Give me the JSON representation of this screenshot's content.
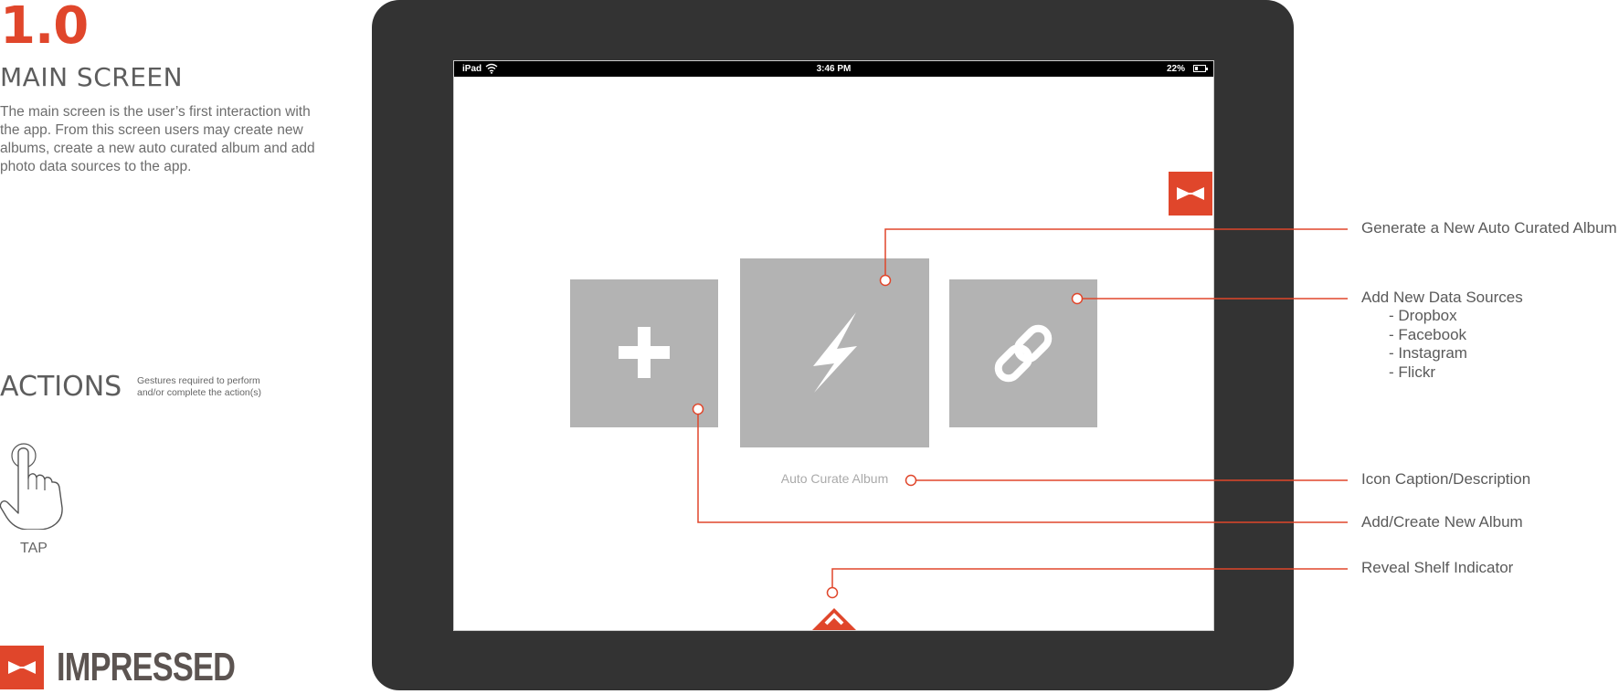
{
  "section": {
    "number": "1.0",
    "title": "MAIN SCREEN",
    "description": "The main screen is the user’s first interaction with the app.  From this screen users may create new albums, create a new auto curated album and add photo data sources to the app."
  },
  "actions": {
    "title": "ACTIONS",
    "note": "Gestures required to perform and/or complete the action(s)",
    "gesture_label": "TAP"
  },
  "brand": {
    "name": "IMPRESSED"
  },
  "status_bar": {
    "carrier": "iPad",
    "time": "3:46 PM",
    "battery": "22%"
  },
  "screen": {
    "caption": "Auto Curate Album",
    "icons": {
      "menu": "bowtie-icon",
      "add_album": "plus-icon",
      "auto_curate": "lightning-bolt-icon",
      "data_sources": "link-icon",
      "shelf": "chevron-up-icon"
    }
  },
  "callouts": {
    "generate": "Generate a New Auto Curated Album",
    "sources": "Add New Data Sources",
    "sources_list": [
      "- Dropbox",
      "- Facebook",
      "- Instagram",
      "- Flickr"
    ],
    "caption": "Icon Caption/Description",
    "add_album": "Add/Create New Album",
    "shelf": "Reveal Shelf Indicator"
  },
  "colors": {
    "accent": "#e0462b",
    "device": "#333333",
    "tile": "#b3b3b3",
    "text": "#5a5a5a"
  }
}
